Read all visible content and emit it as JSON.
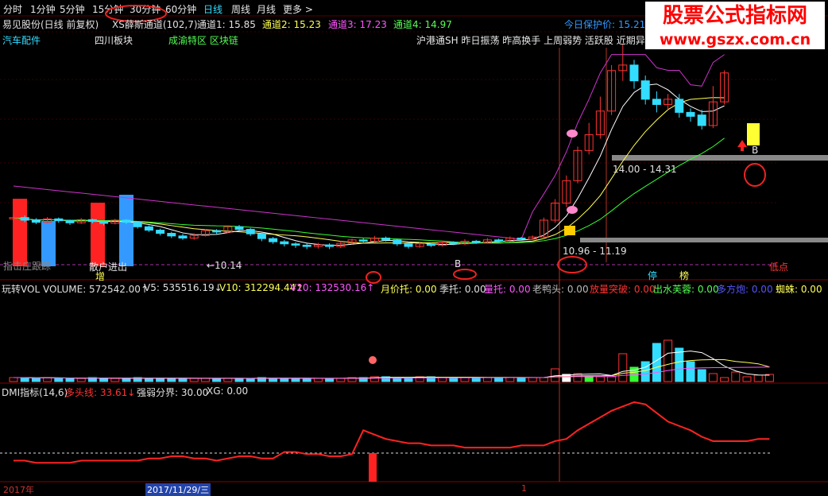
{
  "toolbar": {
    "items": [
      "分时",
      "1分钟",
      "5分钟",
      "15分钟",
      "30分钟",
      "60分钟",
      "日线",
      "周线",
      "月线",
      "更多 >"
    ],
    "active": "日线"
  },
  "watermark": {
    "line1": "股票公式指标网",
    "line2": "www.gszx.com.cn"
  },
  "main_panel": {
    "title": "易见股份(日线 前复权)",
    "indicator_name": "XS薛斯通道(102,7)",
    "channel1": "通道1: 15.85",
    "channel2": "通道2: 15.23",
    "channel3": "通道3: 17.23",
    "channel4": "通道4: 14.97",
    "protect_price": "今日保护价: 15.21",
    "sectors": [
      "汽车配件",
      "四川板块",
      "成渝特区 区块链"
    ],
    "tags_line": "沪港通SH 昨日振荡 昨高换手 上周弱势 活跃股 近期异动",
    "annotations": {
      "price_low": "←10.14",
      "zone_upper": "14.00 - 14.31",
      "zone_lower": "10.96 - 11.19",
      "low_point": "低点",
      "left_text": "指击庄跟踪",
      "left_text2": "散户进出",
      "zeng": "增",
      "b1": "B",
      "b2": "B",
      "ting": "停",
      "bang": "榜"
    }
  },
  "volume_panel": {
    "labels": [
      {
        "text": "玩转VOL VOLUME: 572542.00↑",
        "color": "#e0e0e0"
      },
      {
        "text": "V5: 535516.19↓",
        "color": "#e0e0e0"
      },
      {
        "text": "V10: 312294.44↑",
        "color": "#ffff55"
      },
      {
        "text": "V20: 132530.16↑",
        "color": "#ff55ff"
      },
      {
        "text": "月价托: 0.00",
        "color": "#ffff55"
      },
      {
        "text": "季托: 0.00",
        "color": "#e0e0e0"
      },
      {
        "text": "量托: 0.00",
        "color": "#ff55ff"
      },
      {
        "text": "老鸭头: 0.00",
        "color": "#bbbbbb"
      },
      {
        "text": "放量突破: 0.00",
        "color": "#ff3333"
      },
      {
        "text": "出水芙蓉: 0.00",
        "color": "#55ff55"
      },
      {
        "text": "多方炮: 0.00",
        "color": "#5555ff"
      },
      {
        "text": "蜘蛛: 0.00",
        "color": "#ffff55"
      }
    ]
  },
  "dmi_panel": {
    "labels": [
      {
        "text": "DMI指标(14,6)",
        "color": "#e0e0e0"
      },
      {
        "text": "多头线: 33.61↓",
        "color": "#ff3333"
      },
      {
        "text": "强弱分界: 30.00",
        "color": "#e0e0e0"
      },
      {
        "text": "XG: 0.00",
        "color": "#e0e0e0"
      }
    ]
  },
  "date_axis": {
    "year": "2017年",
    "date": "2017/11/29/三",
    "tick": "1"
  },
  "colors": {
    "up": "#ff3333",
    "down": "#33ddff",
    "bg": "#000000",
    "ma_white": "#ffffff",
    "ma_yellow": "#ffff55",
    "ma_purple": "#cc33cc",
    "ma_green": "#33ff33",
    "dmi": "#ff2222",
    "grid": "#8b0000"
  },
  "chart_data": {
    "type": "candlestick",
    "dates_shown": [
      "2017年",
      "2017/11/29/三"
    ],
    "price_low": 10.14,
    "channels": {
      "channel1": 15.85,
      "channel2": 15.23,
      "channel3": 17.23,
      "channel4": 14.97,
      "protect_price": 15.21
    },
    "zones": [
      [
        14.0,
        14.31
      ],
      [
        10.96,
        11.19
      ]
    ],
    "candles": [
      {
        "o": 11.35,
        "c": 11.4,
        "h": 11.5,
        "l": 11.25
      },
      {
        "o": 11.4,
        "c": 11.3,
        "h": 11.48,
        "l": 11.22
      },
      {
        "o": 11.3,
        "c": 11.22,
        "h": 11.38,
        "l": 11.15
      },
      {
        "o": 11.22,
        "c": 11.35,
        "h": 11.42,
        "l": 11.18
      },
      {
        "o": 11.35,
        "c": 11.28,
        "h": 11.4,
        "l": 11.2
      },
      {
        "o": 11.28,
        "c": 11.2,
        "h": 11.32,
        "l": 11.12
      },
      {
        "o": 11.2,
        "c": 11.32,
        "h": 11.38,
        "l": 11.16
      },
      {
        "o": 11.32,
        "c": 11.25,
        "h": 11.36,
        "l": 11.18
      },
      {
        "o": 11.25,
        "c": 11.18,
        "h": 11.3,
        "l": 11.1
      },
      {
        "o": 11.18,
        "c": 11.3,
        "h": 11.35,
        "l": 11.14
      },
      {
        "o": 11.3,
        "c": 11.22,
        "h": 11.34,
        "l": 11.15
      },
      {
        "o": 11.22,
        "c": 11.05,
        "h": 11.26,
        "l": 10.98
      },
      {
        "o": 11.05,
        "c": 10.92,
        "h": 11.1,
        "l": 10.85
      },
      {
        "o": 10.92,
        "c": 10.8,
        "h": 10.98,
        "l": 10.72
      },
      {
        "o": 10.8,
        "c": 10.7,
        "h": 10.86,
        "l": 10.62
      },
      {
        "o": 10.7,
        "c": 10.62,
        "h": 10.78,
        "l": 10.55
      },
      {
        "o": 10.62,
        "c": 10.72,
        "h": 10.8,
        "l": 10.55
      },
      {
        "o": 10.72,
        "c": 10.9,
        "h": 10.95,
        "l": 10.68
      },
      {
        "o": 10.9,
        "c": 10.85,
        "h": 10.96,
        "l": 10.78
      },
      {
        "o": 10.85,
        "c": 11.05,
        "h": 11.1,
        "l": 10.8
      },
      {
        "o": 11.05,
        "c": 10.95,
        "h": 11.12,
        "l": 10.88
      },
      {
        "o": 10.95,
        "c": 10.78,
        "h": 11.0,
        "l": 10.7
      },
      {
        "o": 10.78,
        "c": 10.6,
        "h": 10.82,
        "l": 10.5
      },
      {
        "o": 10.6,
        "c": 10.48,
        "h": 10.66,
        "l": 10.4
      },
      {
        "o": 10.48,
        "c": 10.4,
        "h": 10.55,
        "l": 10.3
      },
      {
        "o": 10.4,
        "c": 10.35,
        "h": 10.46,
        "l": 10.25
      },
      {
        "o": 10.35,
        "c": 10.3,
        "h": 10.42,
        "l": 10.2
      },
      {
        "o": 10.3,
        "c": 10.36,
        "h": 10.44,
        "l": 10.22
      },
      {
        "o": 10.36,
        "c": 10.3,
        "h": 10.42,
        "l": 10.2
      },
      {
        "o": 10.3,
        "c": 10.42,
        "h": 10.5,
        "l": 10.24
      },
      {
        "o": 10.42,
        "c": 10.55,
        "h": 10.6,
        "l": 10.38
      },
      {
        "o": 10.55,
        "c": 10.5,
        "h": 10.62,
        "l": 10.42
      },
      {
        "o": 10.5,
        "c": 10.62,
        "h": 10.7,
        "l": 10.45
      },
      {
        "o": 10.62,
        "c": 10.55,
        "h": 10.68,
        "l": 10.48
      },
      {
        "o": 10.55,
        "c": 10.4,
        "h": 10.6,
        "l": 10.32
      },
      {
        "o": 10.4,
        "c": 10.3,
        "h": 10.45,
        "l": 10.22
      },
      {
        "o": 10.3,
        "c": 10.4,
        "h": 10.48,
        "l": 10.25
      },
      {
        "o": 10.4,
        "c": 10.34,
        "h": 10.45,
        "l": 10.28
      },
      {
        "o": 10.34,
        "c": 10.45,
        "h": 10.52,
        "l": 10.3
      },
      {
        "o": 10.45,
        "c": 10.4,
        "h": 10.5,
        "l": 10.35
      },
      {
        "o": 10.4,
        "c": 10.5,
        "h": 10.58,
        "l": 10.36
      },
      {
        "o": 10.5,
        "c": 10.45,
        "h": 10.55,
        "l": 10.4
      },
      {
        "o": 10.45,
        "c": 10.55,
        "h": 10.62,
        "l": 10.42
      },
      {
        "o": 10.55,
        "c": 10.5,
        "h": 10.6,
        "l": 10.45
      },
      {
        "o": 10.5,
        "c": 10.62,
        "h": 10.68,
        "l": 10.46
      },
      {
        "o": 10.62,
        "c": 10.58,
        "h": 10.66,
        "l": 10.52
      },
      {
        "o": 10.58,
        "c": 10.66,
        "h": 10.72,
        "l": 10.55
      },
      {
        "o": 10.66,
        "c": 11.3,
        "h": 11.4,
        "l": 10.6
      },
      {
        "o": 11.3,
        "c": 11.95,
        "h": 12.1,
        "l": 11.2
      },
      {
        "o": 11.95,
        "c": 12.8,
        "h": 13.0,
        "l": 11.8
      },
      {
        "o": 12.8,
        "c": 13.95,
        "h": 14.1,
        "l": 12.7
      },
      {
        "o": 13.95,
        "c": 14.55,
        "h": 15.0,
        "l": 13.8
      },
      {
        "o": 14.55,
        "c": 15.45,
        "h": 16.0,
        "l": 14.4
      },
      {
        "o": 15.45,
        "c": 16.99,
        "h": 17.2,
        "l": 15.3
      },
      {
        "o": 16.99,
        "c": 17.2,
        "h": 18.0,
        "l": 16.6
      },
      {
        "o": 17.2,
        "c": 16.6,
        "h": 17.4,
        "l": 16.3
      },
      {
        "o": 16.6,
        "c": 15.9,
        "h": 16.8,
        "l": 15.7
      },
      {
        "o": 15.9,
        "c": 15.7,
        "h": 16.2,
        "l": 15.4
      },
      {
        "o": 15.7,
        "c": 15.9,
        "h": 16.1,
        "l": 15.5
      },
      {
        "o": 15.9,
        "c": 15.4,
        "h": 16.1,
        "l": 15.2
      },
      {
        "o": 15.4,
        "c": 15.25,
        "h": 15.55,
        "l": 15.05
      },
      {
        "o": 15.3,
        "c": 14.9,
        "h": 15.5,
        "l": 14.75
      },
      {
        "o": 14.9,
        "c": 15.8,
        "h": 16.4,
        "l": 14.8
      },
      {
        "o": 15.8,
        "c": 16.9,
        "h": 17.0,
        "l": 15.7
      }
    ],
    "volume": [
      0.05,
      0.05,
      0.04,
      0.05,
      0.04,
      0.04,
      0.04,
      0.05,
      0.04,
      0.04,
      0.04,
      0.05,
      0.04,
      0.04,
      0.04,
      0.04,
      0.04,
      0.04,
      0.04,
      0.04,
      0.04,
      0.04,
      0.05,
      0.04,
      0.04,
      0.04,
      0.04,
      0.04,
      0.04,
      0.04,
      0.05,
      0.05,
      0.06,
      0.06,
      0.05,
      0.05,
      0.06,
      0.06,
      0.05,
      0.05,
      0.05,
      0.05,
      0.05,
      0.05,
      0.05,
      0.05,
      0.05,
      0.05,
      0.16,
      0.09,
      0.1,
      0.07,
      0.06,
      0.06,
      0.35,
      0.18,
      0.25,
      0.48,
      0.52,
      0.42,
      0.25,
      0.15,
      0.1,
      0.05,
      0.12,
      0.06,
      0.08,
      0.09
    ],
    "dmi": [
      24,
      24,
      23,
      23,
      23,
      23,
      24,
      24,
      24,
      24,
      24,
      24,
      25,
      25,
      26,
      26,
      25,
      25,
      24,
      25,
      26,
      26,
      25,
      25,
      28,
      28,
      27,
      27,
      26,
      26,
      27,
      38,
      36,
      34,
      33,
      32,
      32,
      31,
      31,
      31,
      30,
      30,
      30,
      30,
      30,
      31,
      31,
      31,
      33,
      34,
      38,
      41,
      44,
      47,
      49,
      51,
      50,
      46,
      42,
      40,
      38,
      35,
      33,
      33,
      33,
      33,
      34,
      34
    ]
  }
}
